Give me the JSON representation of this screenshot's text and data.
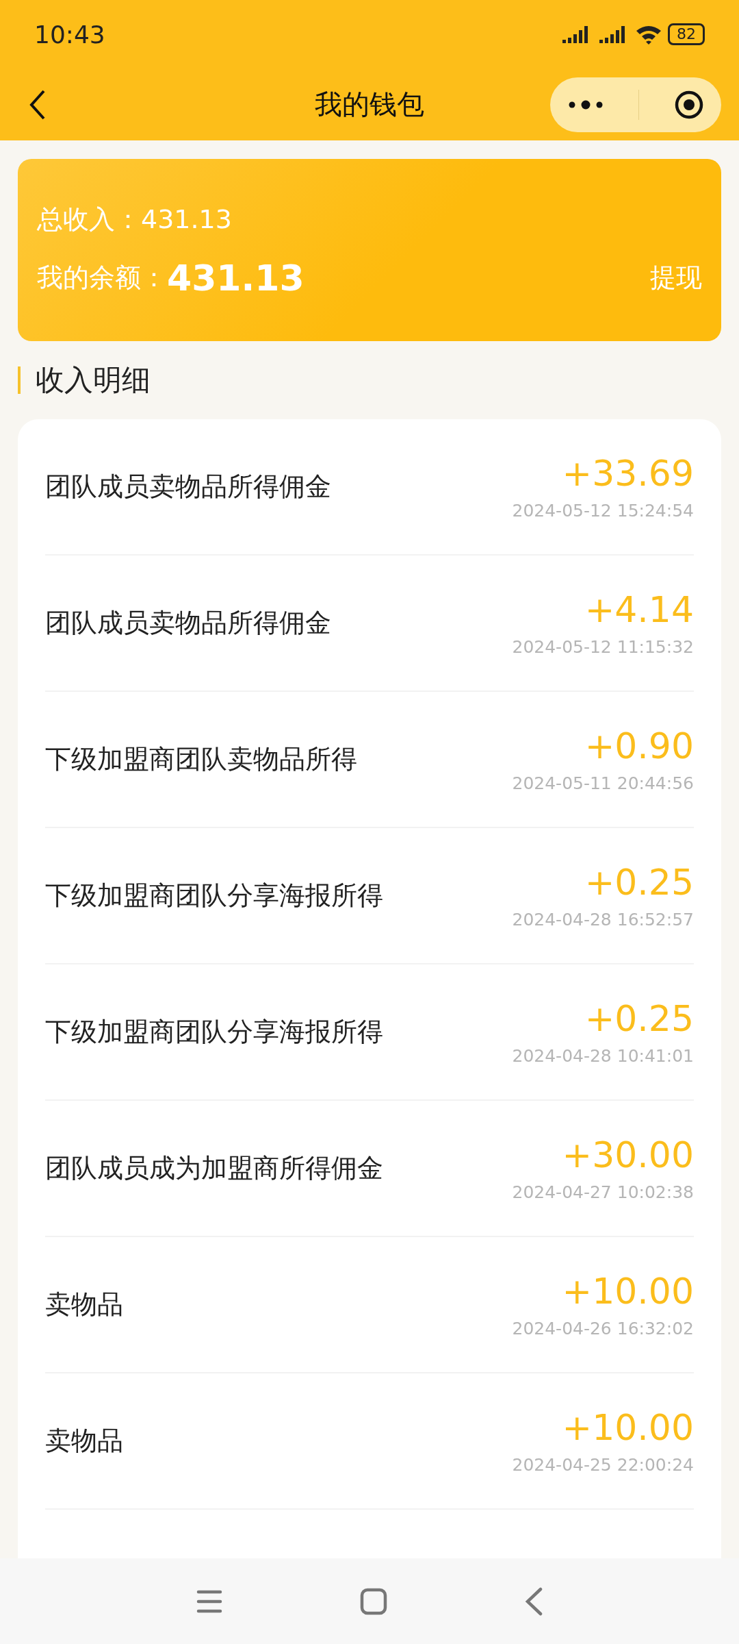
{
  "status_bar": {
    "time": "10:43",
    "battery": "82"
  },
  "header": {
    "title": "我的钱包"
  },
  "summary": {
    "total_label": "总收入：",
    "total_value": "431.13",
    "balance_label": "我的余额：",
    "balance_value": "431.13",
    "withdraw": "提现"
  },
  "section_title": "收入明细",
  "records": [
    {
      "title": "团队成员卖物品所得佣金",
      "amount": "+33.69",
      "time": "2024-05-12 15:24:54"
    },
    {
      "title": "团队成员卖物品所得佣金",
      "amount": "+4.14",
      "time": "2024-05-12 11:15:32"
    },
    {
      "title": "下级加盟商团队卖物品所得",
      "amount": "+0.90",
      "time": "2024-05-11 20:44:56"
    },
    {
      "title": "下级加盟商团队分享海报所得",
      "amount": "+0.25",
      "time": "2024-04-28 16:52:57"
    },
    {
      "title": "下级加盟商团队分享海报所得",
      "amount": "+0.25",
      "time": "2024-04-28 10:41:01"
    },
    {
      "title": "团队成员成为加盟商所得佣金",
      "amount": "+30.00",
      "time": "2024-04-27 10:02:38"
    },
    {
      "title": "卖物品",
      "amount": "+10.00",
      "time": "2024-04-26 16:32:02"
    },
    {
      "title": "卖物品",
      "amount": "+10.00",
      "time": "2024-04-25 22:00:24"
    }
  ]
}
